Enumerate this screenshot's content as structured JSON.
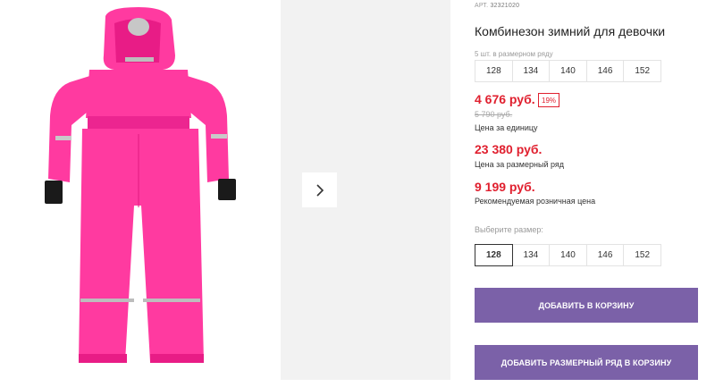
{
  "product": {
    "sku_label": "АРТ.",
    "sku_value": "32321020",
    "title": "Комбинезон зимний для девочки",
    "pack_note": "5 шт. в размерном ряду",
    "pack_sizes": [
      "128",
      "134",
      "140",
      "146",
      "152"
    ],
    "price_unit": "4 676 руб.",
    "discount_badge": "19%",
    "old_price": "5 790 руб.",
    "price_unit_caption": "Цена за единицу",
    "price_pack": "23 380 руб.",
    "price_pack_caption": "Цена за размерный ряд",
    "price_retail": "9 199 руб.",
    "price_retail_caption": "Рекомендуемая розничная цена",
    "choose_size_label": "Выберите размер:",
    "sizes": [
      "128",
      "134",
      "140",
      "146",
      "152"
    ],
    "selected_size": "128",
    "add_to_cart_label": "ДОБАВИТЬ В КОРЗИНУ",
    "add_pack_to_cart_label": "ДОБАВИТЬ РАЗМЕРНЫЙ РЯД В КОРЗИНУ"
  },
  "colors": {
    "price_red": "#e0202f",
    "button_purple": "#7b61a8",
    "garment_pink": "#ff2e9a"
  },
  "icons": {
    "next": "chevron-right-icon"
  }
}
